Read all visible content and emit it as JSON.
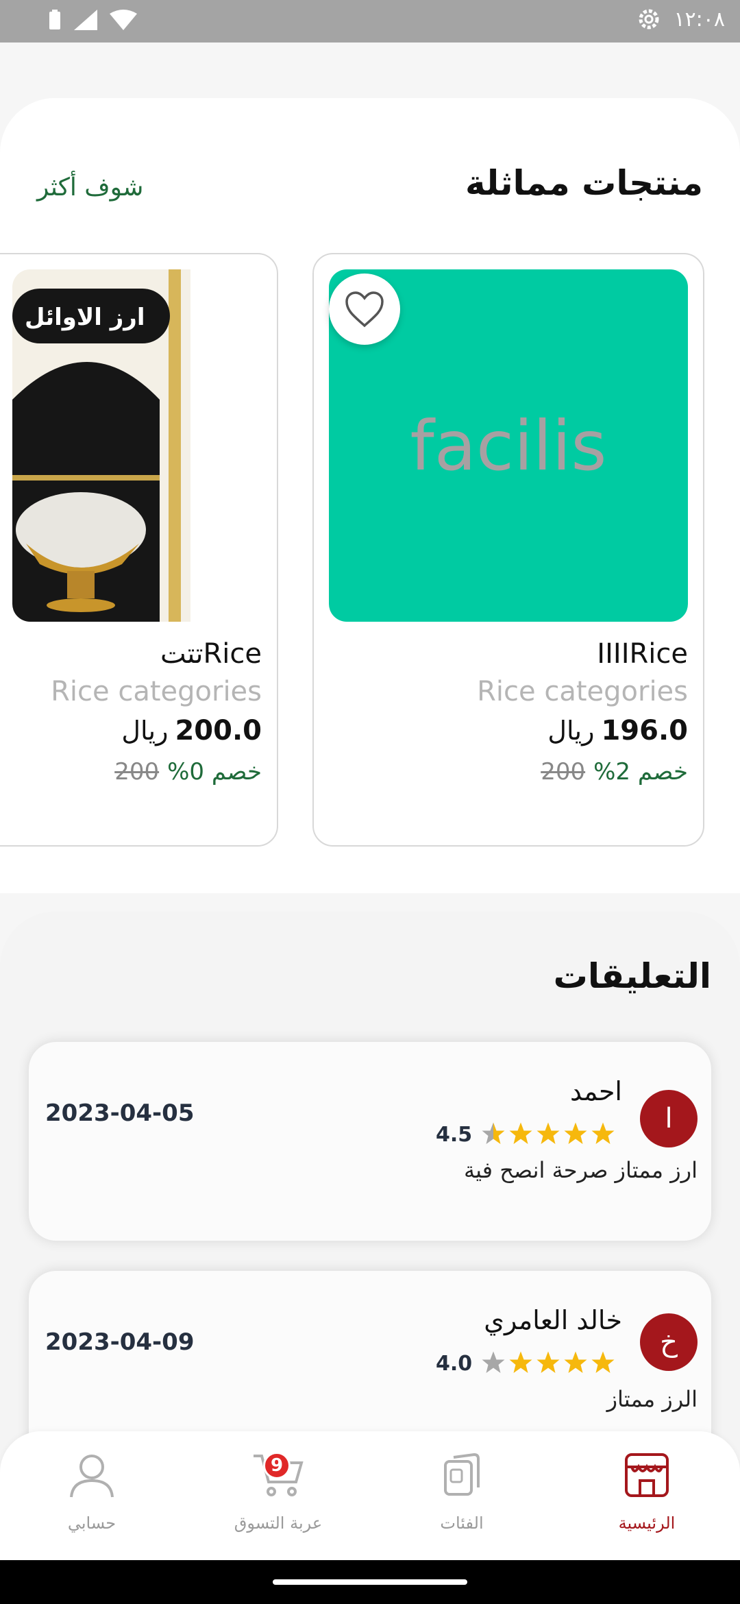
{
  "status_bar": {
    "time": "١٢:٠٨"
  },
  "similar": {
    "title": "منتجات مماثلة",
    "see_more": "شوف أكثر",
    "products": [
      {
        "image_text": "facilis",
        "name": "IIIIRice",
        "category": "Rice categories",
        "price": "196.0",
        "currency": "ريال",
        "old_price": "200",
        "discount": "خصم 2%",
        "image_color": "#00cba2"
      },
      {
        "name": "تتتRice",
        "category": "Rice categories",
        "price": "200.0",
        "currency": "ريال",
        "old_price": "200",
        "discount": "خصم 0%",
        "package_text": "ارز الاوائل"
      }
    ]
  },
  "comments": {
    "title": "التعليقات",
    "items": [
      {
        "initial": "ا",
        "name": "احمد",
        "rating": "4.5",
        "text": "ارز ممتاز صرحة انصح فية",
        "date": "2023-04-05"
      },
      {
        "initial": "خ",
        "name": "خالد العامري",
        "rating": "4.0",
        "text": "الرز ممتاز",
        "date": "2023-04-09"
      }
    ]
  },
  "nav": {
    "items": [
      {
        "label": "الرئيسية",
        "icon": "store-icon",
        "active": true
      },
      {
        "label": "الفئات",
        "icon": "categories-icon"
      },
      {
        "label": "عربة التسوق",
        "icon": "cart-icon",
        "badge": "9"
      },
      {
        "label": "حسابي",
        "icon": "user-icon"
      }
    ]
  },
  "colors": {
    "accent": "#a4171c",
    "green": "#1f6b3a",
    "product_green": "#00cba2",
    "star": "#f6b80d"
  }
}
